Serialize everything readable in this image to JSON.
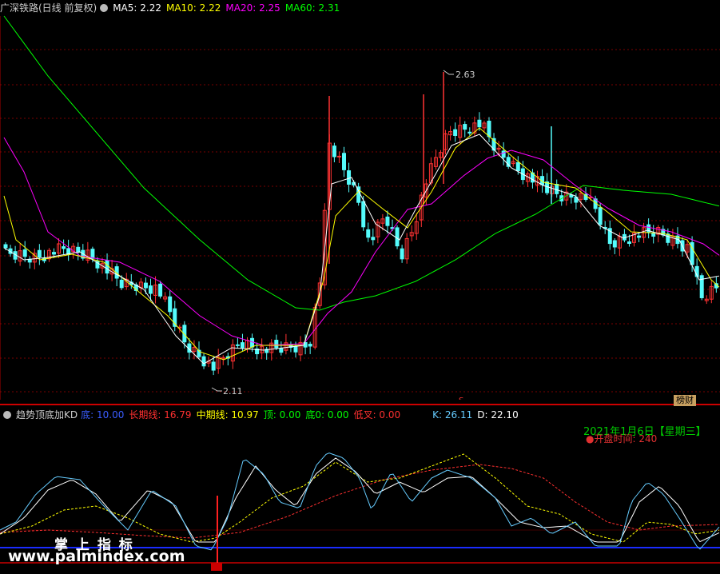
{
  "header": {
    "title": "广深铁路(日线 前复权)",
    "ma": [
      {
        "label": "MA5: 2.22",
        "color": "#ffffff"
      },
      {
        "label": "MA10: 2.22",
        "color": "#ffff00"
      },
      {
        "label": "MA20: 2.25",
        "color": "#ff00ff"
      },
      {
        "label": "MA60: 2.31",
        "color": "#00ff00"
      }
    ]
  },
  "annotations": {
    "high": "2.63",
    "low": "2.11",
    "bang_tag": "榜财"
  },
  "indicator": {
    "title": "趋势顶底加KD",
    "fields": [
      {
        "label": "底: 10.00",
        "color": "#3a5cff"
      },
      {
        "label": "长期线: 16.79",
        "color": "#ff3030"
      },
      {
        "label": "中期线: 10.97",
        "color": "#ffff00"
      },
      {
        "label": "顶: 0.00",
        "color": "#00ff00"
      },
      {
        "label": "底0: 0.00",
        "color": "#00ff00"
      },
      {
        "label": "低叉: 0.00",
        "color": "#ff3030"
      },
      {
        "label": "K: 26.11",
        "color": "#66ccff"
      },
      {
        "label": "D: 22.10",
        "color": "#ffffff"
      }
    ]
  },
  "info": {
    "date": "2021年1月6日【星期三】",
    "open_time": "●开盘时间:  240"
  },
  "watermark": {
    "cn": "掌 上 指 标",
    "url": "www.palmindex.com"
  },
  "colors": {
    "up": "#ff3232",
    "down": "#54fcfc",
    "ma5": "#ffffff",
    "ma10": "#ffff00",
    "ma20": "#ff00ff",
    "ma60": "#00ff00",
    "grid": "#7a0000"
  },
  "icons": {
    "menu": "circle-icon"
  }
}
